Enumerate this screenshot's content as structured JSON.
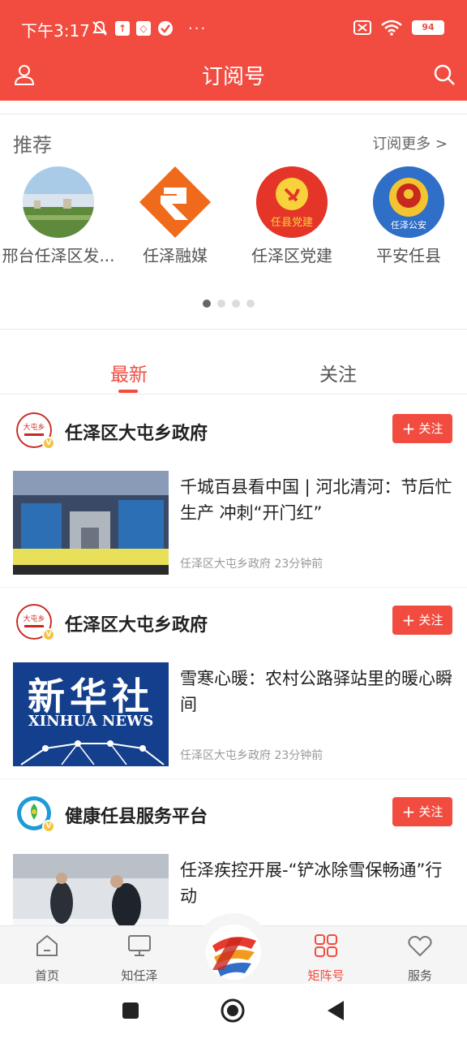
{
  "status": {
    "time": "下午3:17",
    "dots": "···",
    "battery": "94"
  },
  "header": {
    "title": "订阅号"
  },
  "recommend": {
    "title": "推荐",
    "more": "订阅更多 >",
    "items": [
      {
        "label": "邢台任泽区发..."
      },
      {
        "label": "任泽融媒"
      },
      {
        "label": "任泽区党建",
        "logo_text": "任县党建"
      },
      {
        "label": "平安任县",
        "logo_text": "任泽公安"
      }
    ]
  },
  "tabs": [
    {
      "label": "最新",
      "active": true
    },
    {
      "label": "关注",
      "active": false
    }
  ],
  "feed": [
    {
      "account": "任泽区大屯乡政府",
      "follow": "关注",
      "title": "千城百县看中国 | 河北清河：节后忙生产 冲刺“开门红”",
      "meta": "任泽区大屯乡政府  23分钟前"
    },
    {
      "account": "任泽区大屯乡政府",
      "follow": "关注",
      "title": "雪寒心暖：农村公路驿站里的暖心瞬间",
      "meta": "任泽区大屯乡政府  23分钟前",
      "thumb_text_cn": "新华社",
      "thumb_text_en": "XINHUA NEWS"
    },
    {
      "account": "健康任县服务平台",
      "follow": "关注",
      "title": "任泽疾控开展-“铲冰除雪保畅通”行动"
    }
  ],
  "nav": [
    {
      "label": "首页",
      "icon": "home-icon"
    },
    {
      "label": "知任泽",
      "icon": "monitor-icon"
    },
    {
      "label": "矩阵号",
      "icon": "grid-icon",
      "active": true
    },
    {
      "label": "服务",
      "icon": "heart-icon"
    }
  ],
  "colors": {
    "brand": "#f24c40",
    "text": "#222222",
    "muted": "#999999"
  }
}
